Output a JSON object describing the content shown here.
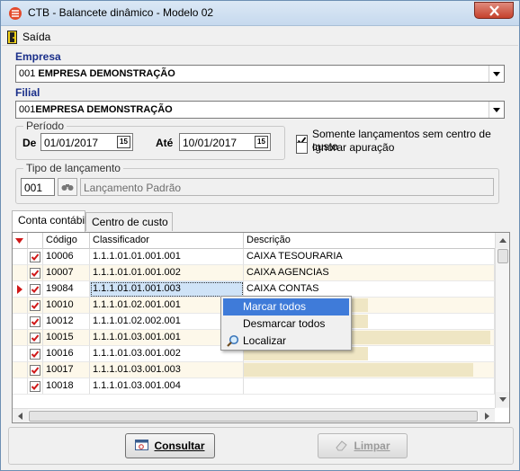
{
  "window": {
    "title": "CTB - Balancete dinâmico - Modelo 02"
  },
  "menu": {
    "exit_label": "Saída"
  },
  "empresa": {
    "label": "Empresa",
    "code": "001",
    "name": "EMPRESA DEMONSTRAÇÃO"
  },
  "filial": {
    "label": "Filial",
    "code": "001",
    "name": "EMPRESA DEMONSTRAÇÃO"
  },
  "periodo": {
    "title": "Período",
    "de_label": "De",
    "de_value": "01/01/2017",
    "ate_label": "Até",
    "ate_value": "10/01/2017",
    "cal_icon_text": "15"
  },
  "options": {
    "somente_label": "Somente lançamentos sem centro de custo",
    "somente_checked": true,
    "ignorar_label": "Ignorar apuração",
    "ignorar_checked": false
  },
  "tipo": {
    "title": "Tipo de lançamento",
    "code": "001",
    "description": "Lançamento Padrão"
  },
  "tabs": [
    {
      "label": "Conta contábil",
      "active": true
    },
    {
      "label": "Centro de custo",
      "active": false
    }
  ],
  "grid": {
    "columns": [
      "Código",
      "Classificador",
      "Descrição"
    ],
    "rows": [
      {
        "codigo": "10006",
        "classificador": "1.1.1.01.01.001.001",
        "descricao": "CAIXA TESOURARIA",
        "checked": true
      },
      {
        "codigo": "10007",
        "classificador": "1.1.1.01.01.001.002",
        "descricao": "CAIXA AGENCIAS",
        "checked": true
      },
      {
        "codigo": "19084",
        "classificador": "1.1.1.01.01.001.003",
        "descricao": "CAIXA CONTAS",
        "checked": true,
        "current": true
      },
      {
        "codigo": "10010",
        "classificador": "1.1.1.01.02.001.001",
        "descricao": "",
        "checked": true
      },
      {
        "codigo": "10012",
        "classificador": "1.1.1.01.02.002.001",
        "descricao": "",
        "checked": true
      },
      {
        "codigo": "10015",
        "classificador": "1.1.1.01.03.001.001",
        "descricao": "",
        "checked": true
      },
      {
        "codigo": "10016",
        "classificador": "1.1.1.01.03.001.002",
        "descricao": "",
        "checked": true
      },
      {
        "codigo": "10017",
        "classificador": "1.1.1.01.03.001.003",
        "descricao": "",
        "checked": true
      },
      {
        "codigo": "10018",
        "classificador": "1.1.1.01.03.001.004",
        "descricao": "",
        "checked": true
      }
    ]
  },
  "context_menu": {
    "items": [
      {
        "label": "Marcar todos",
        "highlighted": true
      },
      {
        "label": "Desmarcar todos",
        "highlighted": false
      },
      {
        "label": "Localizar",
        "highlighted": false,
        "icon": "magnifier-icon"
      }
    ]
  },
  "buttons": {
    "consultar_label": "Consultar",
    "limpar_label": "Limpar"
  },
  "colors": {
    "label_blue": "#1a2f8a",
    "row_alt": "#fdf8ea",
    "row_blurred": "#efe6c4",
    "menu_highlight": "#3f7bd9",
    "check_red": "#d01818"
  }
}
